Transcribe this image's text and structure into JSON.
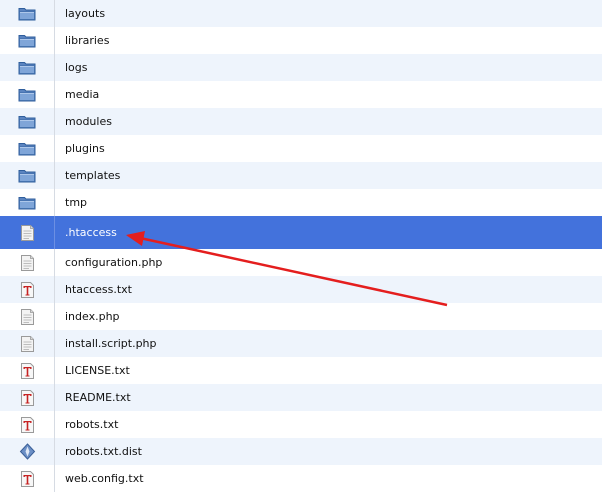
{
  "accent_selected": "#4372dc",
  "annotation_color": "#e41e1e",
  "files": [
    {
      "name": "layouts",
      "icon": "folder-icon"
    },
    {
      "name": "libraries",
      "icon": "folder-icon"
    },
    {
      "name": "logs",
      "icon": "folder-icon"
    },
    {
      "name": "media",
      "icon": "folder-icon"
    },
    {
      "name": "modules",
      "icon": "folder-icon"
    },
    {
      "name": "plugins",
      "icon": "folder-icon"
    },
    {
      "name": "templates",
      "icon": "folder-icon"
    },
    {
      "name": "tmp",
      "icon": "folder-icon"
    },
    {
      "name": ".htaccess",
      "icon": "file-icon",
      "selected": true
    },
    {
      "name": "configuration.php",
      "icon": "file-icon"
    },
    {
      "name": "htaccess.txt",
      "icon": "text-file-icon"
    },
    {
      "name": "index.php",
      "icon": "file-icon"
    },
    {
      "name": "install.script.php",
      "icon": "file-icon"
    },
    {
      "name": "LICENSE.txt",
      "icon": "text-file-icon"
    },
    {
      "name": "README.txt",
      "icon": "text-file-icon"
    },
    {
      "name": "robots.txt",
      "icon": "text-file-icon"
    },
    {
      "name": "robots.txt.dist",
      "icon": "dist-file-icon"
    },
    {
      "name": "web.config.txt",
      "icon": "text-file-icon"
    }
  ]
}
